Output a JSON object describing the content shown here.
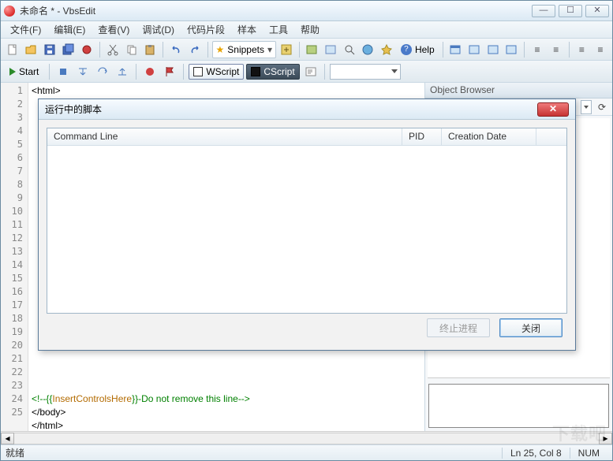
{
  "window": {
    "title": "未命名 * - VbsEdit"
  },
  "menu": {
    "file": "文件(F)",
    "edit": "编辑(E)",
    "view": "查看(V)",
    "debug": "调试(D)",
    "snippets": "代码片段",
    "samples": "样本",
    "tools": "工具",
    "help": "帮助"
  },
  "toolbar": {
    "snippets_label": "Snippets",
    "help_label": "Help"
  },
  "run": {
    "start": "Start",
    "wscript": "WScript",
    "cscript": "CScript"
  },
  "panel": {
    "object_browser": "Object Browser"
  },
  "code": {
    "l1": "<html>",
    "l23a": "<!--{{",
    "l23b": "InsertControlsHere",
    "l23c": "}}-Do not remove this line-->",
    "l24": "</body>",
    "l25": "</html>"
  },
  "modal": {
    "title": "运行中的脚本",
    "col_cmd": "Command Line",
    "col_pid": "PID",
    "col_date": "Creation Date",
    "btn_kill": "终止进程",
    "btn_close": "关闭"
  },
  "status": {
    "ready": "就绪",
    "pos": "Ln 25, Col 8",
    "num": "NUM"
  },
  "watermark": "下载吧"
}
